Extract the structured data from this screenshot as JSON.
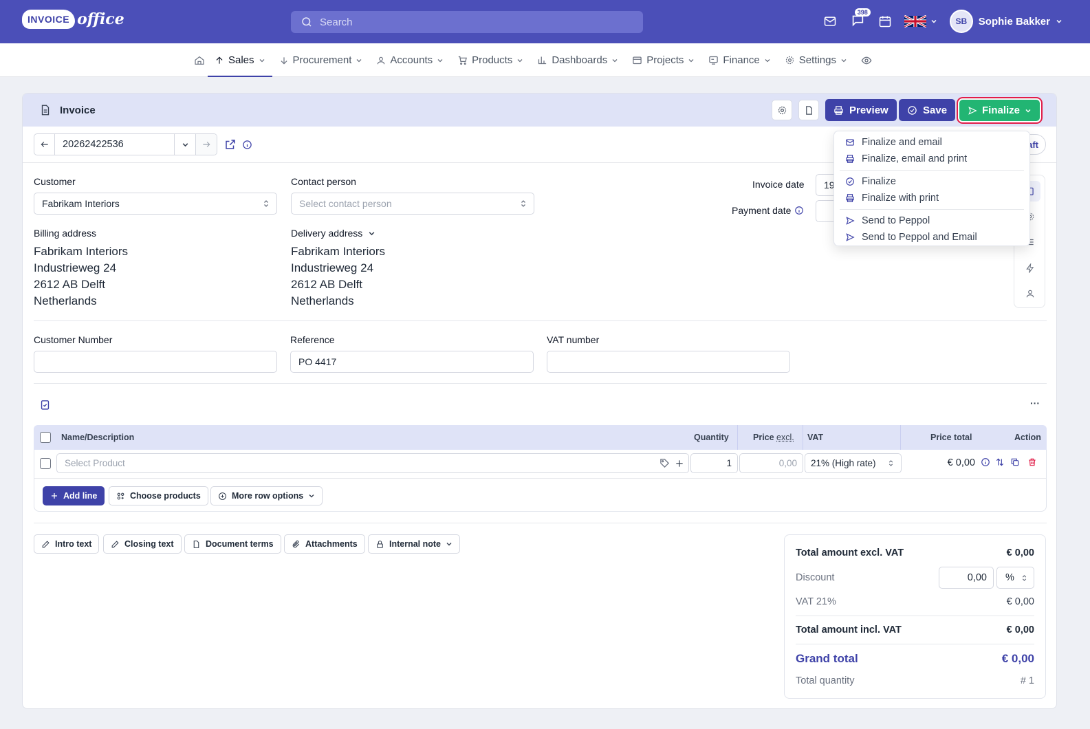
{
  "app": {
    "logo_main": "INVOICE",
    "logo_sub": "office",
    "search_placeholder": "Search",
    "notifications_count": "398",
    "user_initials": "SB",
    "user_name": "Sophie Bakker"
  },
  "nav": {
    "items": [
      {
        "label": "Sales"
      },
      {
        "label": "Procurement"
      },
      {
        "label": "Accounts"
      },
      {
        "label": "Products"
      },
      {
        "label": "Dashboards"
      },
      {
        "label": "Projects"
      },
      {
        "label": "Finance"
      },
      {
        "label": "Settings"
      }
    ]
  },
  "invoice": {
    "title": "Invoice",
    "preview_label": "Preview",
    "save_label": "Save",
    "finalize_label": "Finalize",
    "number": "20262422536",
    "status_partial": "aft",
    "customer_label": "Customer",
    "customer_value": "Fabrikam Interiors",
    "contact_label": "Contact person",
    "contact_placeholder": "Select contact person",
    "billing_label": "Billing address",
    "billing": [
      "Fabrikam Interiors",
      "Industrieweg 24",
      "2612 AB Delft",
      "Netherlands"
    ],
    "delivery_label": "Delivery address",
    "delivery": [
      "Fabrikam Interiors",
      "Industrieweg 24",
      "2612 AB Delft",
      "Netherlands"
    ],
    "invoice_date_label": "Invoice date",
    "invoice_date_partial": "19",
    "payment_date_label": "Payment date",
    "customer_number_label": "Customer Number",
    "reference_label": "Reference",
    "reference_value": "PO 4417",
    "vat_number_label": "VAT number"
  },
  "finalize_menu": {
    "items": [
      "Finalize and email",
      "Finalize, email and print",
      "Finalize",
      "Finalize with print",
      "Send to Peppol",
      "Send to Peppol and Email"
    ]
  },
  "table": {
    "headers": {
      "name": "Name/Description",
      "quantity": "Quantity",
      "price": "Price",
      "price_excl": "excl.",
      "vat": "VAT",
      "total": "Price total",
      "action": "Action"
    },
    "row": {
      "product_placeholder": "Select Product",
      "quantity": "1",
      "price": "0,00",
      "vat": "21% (High rate)",
      "total": "€ 0,00"
    },
    "add_line": "Add line",
    "choose_products": "Choose products",
    "more_row_options": "More row options",
    "more_menu": "···"
  },
  "extras": {
    "intro": "Intro text",
    "closing": "Closing text",
    "terms": "Document terms",
    "attachments": "Attachments",
    "internal_note": "Internal note"
  },
  "totals": {
    "excl_label": "Total amount excl. VAT",
    "excl_value": "€ 0,00",
    "discount_label": "Discount",
    "discount_value": "0,00",
    "discount_unit": "%",
    "vat_label": "VAT 21%",
    "vat_value": "€ 0,00",
    "incl_label": "Total amount incl. VAT",
    "incl_value": "€ 0,00",
    "grand_label": "Grand total",
    "grand_value": "€ 0,00",
    "qty_label": "Total quantity",
    "qty_value": "# 1"
  },
  "colors": {
    "brand": "#4b4fb8",
    "accent": "#3e42a8",
    "finalize": "#22b573",
    "header_bg": "#dfe3f7"
  }
}
